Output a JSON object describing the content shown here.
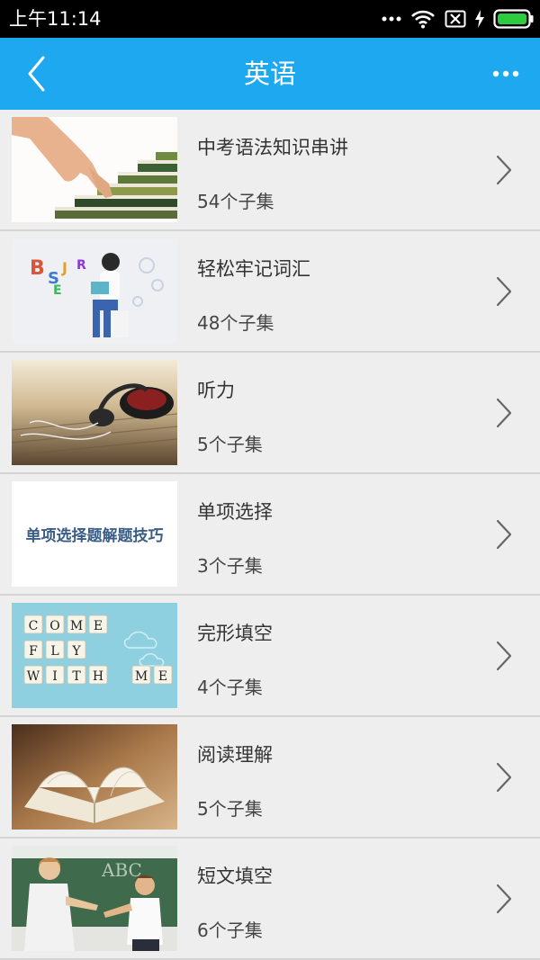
{
  "status_bar": {
    "time": "上午11:14",
    "icons": [
      "more-dots-icon",
      "wifi-icon",
      "sim-off-icon",
      "charging-icon",
      "battery-icon"
    ],
    "battery_color": "#2dcc40"
  },
  "app_bar": {
    "title": "英语",
    "back_icon": "chevron-left-icon",
    "more_icon": "more-horizontal-icon",
    "color": "#1ea8f0"
  },
  "courses": [
    {
      "title": "中考语法知识串讲",
      "episodes": "54个子集",
      "thumb": "hand-climbing-books-image"
    },
    {
      "title": "轻松牢记词汇",
      "episodes": "48个子集",
      "thumb": "child-reading-letters-image"
    },
    {
      "title": "听力",
      "episodes": "5个子集",
      "thumb": "headphones-image"
    },
    {
      "title": "单项选择",
      "episodes": "3个子集",
      "thumb": "single-choice-tips-image",
      "thumb_text": "单项选择题解题技巧"
    },
    {
      "title": "完形填空",
      "episodes": "4个子集",
      "thumb": "scrabble-tiles-image",
      "thumb_text": [
        "COME",
        "FLY",
        "WITH",
        "ME"
      ]
    },
    {
      "title": "阅读理解",
      "episodes": "5个子集",
      "thumb": "open-book-image"
    },
    {
      "title": "短文填空",
      "episodes": "6个子集",
      "thumb": "teacher-and-student-image",
      "thumb_text": "ABC"
    }
  ]
}
